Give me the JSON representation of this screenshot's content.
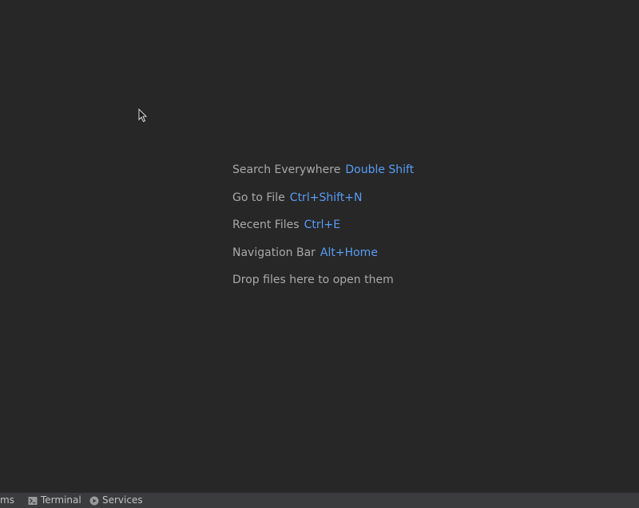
{
  "hints": [
    {
      "label": "Search Everywhere",
      "shortcut": "Double Shift"
    },
    {
      "label": "Go to File",
      "shortcut": "Ctrl+Shift+N"
    },
    {
      "label": "Recent Files",
      "shortcut": "Ctrl+E"
    },
    {
      "label": "Navigation Bar",
      "shortcut": "Alt+Home"
    },
    {
      "label": "Drop files here to open them",
      "shortcut": ""
    }
  ],
  "statusbar": {
    "problems_partial": "ms",
    "terminal_label": "Terminal",
    "services_label": "Services",
    "terminal_icon": "terminal-icon",
    "services_icon": "services-icon"
  },
  "colors": {
    "background": "#272727",
    "hint_text": "#a9a9a9",
    "shortcut_text": "#589df6",
    "statusbar_bg": "#3a3c3e"
  }
}
